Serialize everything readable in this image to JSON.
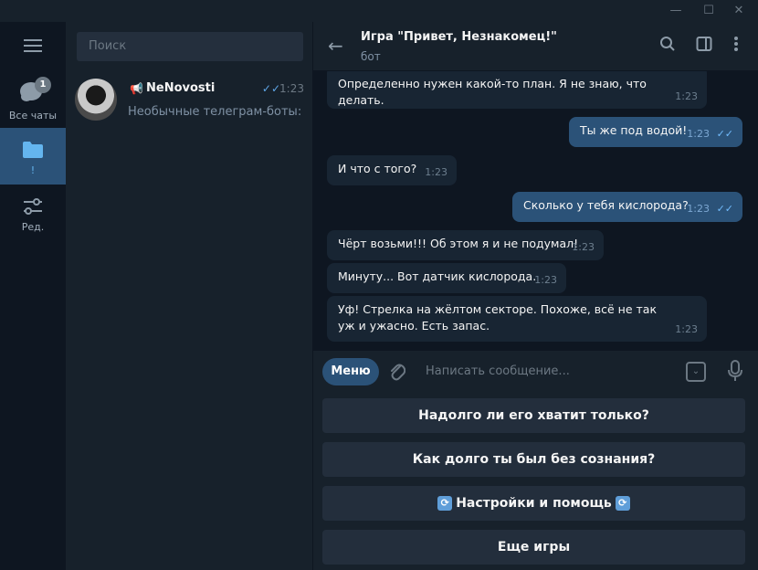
{
  "window": {
    "minimize_icon": "minimize-icon",
    "maximize_icon": "maximize-icon",
    "close_icon": "close-icon"
  },
  "folders": [
    {
      "label": "Все чаты",
      "badge": "1",
      "icon": "chats-icon",
      "active": false
    },
    {
      "label": "!",
      "icon": "folder-icon",
      "active": true
    },
    {
      "label": "Ред.",
      "icon": "edit-filters-icon",
      "active": false
    }
  ],
  "search": {
    "placeholder": "Поиск"
  },
  "dialogs": [
    {
      "name": "NeNovosti",
      "time": "1:23",
      "preview": "Необычные телеграм-боты: ...",
      "channel_icon": "megaphone-icon",
      "read_icon": "double-check-icon"
    }
  ],
  "chat": {
    "title": "Игра \"Привет, Незнакомец!\"",
    "subtitle": "бот",
    "messages": [
      {
        "dir": "in",
        "text": "Определенно нужен какой-то план. Я не знаю, что делать.",
        "time": "1:23"
      },
      {
        "dir": "out",
        "text": "Ты же под водой!",
        "time": "1:23"
      },
      {
        "dir": "in",
        "text": "И что с того?",
        "time": "1:23"
      },
      {
        "dir": "out",
        "text": "Сколько у тебя кислорода?",
        "time": "1:23"
      },
      {
        "dir": "in",
        "text": "Чёрт возьми!!! Об этом я и не подумал!",
        "time": "1:23"
      },
      {
        "dir": "in",
        "text": "Минуту... Вот датчик кислорода.",
        "time": "1:23"
      },
      {
        "dir": "in",
        "text": "Уф! Стрелка на жёлтом секторе. Похоже, всё не так уж и ужасно. Есть запас.",
        "time": "1:23"
      }
    ]
  },
  "composer": {
    "menu_label": "Меню",
    "placeholder": "Написать сообщение..."
  },
  "keyboard": {
    "buttons": [
      "Надолго ли его хватит только?",
      "Как долго ты был без сознания?",
      "Настройки и помощь",
      "Еще игры"
    ]
  },
  "colors": {
    "accent": "#2b5278",
    "background": "#0e1621",
    "panel": "#17212b"
  }
}
